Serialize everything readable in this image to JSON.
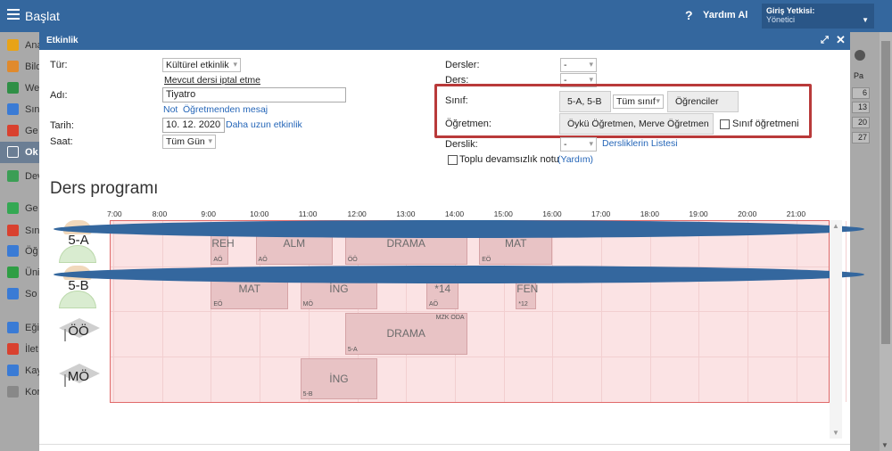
{
  "topbar": {
    "title": "Başlat",
    "help_icon": "?",
    "help_label": "Yardım Al",
    "role_label": "Giriş Yetkisi:",
    "role_value": "Yönetici"
  },
  "sidebar": {
    "items": [
      {
        "label": "Ana",
        "icon": "star-icon",
        "color": "#e8a317"
      },
      {
        "label": "Bild",
        "icon": "mail-icon",
        "color": "#e08a2d"
      },
      {
        "label": "We",
        "icon": "home-icon",
        "color": "#2f8f46"
      },
      {
        "label": "Sın",
        "icon": "board-icon",
        "color": "#3a7bd5"
      },
      {
        "label": "Ge",
        "icon": "person-icon",
        "color": "#d9412f"
      },
      {
        "label": "Ok",
        "icon": "calendar-icon",
        "color": "#ffffff"
      },
      {
        "label": "Dev",
        "icon": "user-icon",
        "color": "#3b9e55"
      },
      {
        "label": "Ge",
        "icon": "check-icon",
        "color": "#34a853"
      },
      {
        "label": "Sın",
        "icon": "badge-icon",
        "color": "#d9412f"
      },
      {
        "label": "Öğ",
        "icon": "card-icon",
        "color": "#3a7bd5"
      },
      {
        "label": "Üni",
        "icon": "shield-icon",
        "color": "#2f9e44"
      },
      {
        "label": "So",
        "icon": "bar-chart-icon",
        "color": "#3a7bd5"
      },
      {
        "label": "Eği",
        "icon": "book-icon",
        "color": "#3a7bd5"
      },
      {
        "label": "İlet",
        "icon": "chat-icon",
        "color": "#d9412f"
      },
      {
        "label": "Kay",
        "icon": "pen-icon",
        "color": "#3a7bd5"
      },
      {
        "label": "Kor",
        "icon": "gear-icon",
        "color": "#888888"
      }
    ]
  },
  "background_panel": {
    "col_header": "Pa",
    "numbers": [
      "6",
      "13",
      "20",
      "27"
    ]
  },
  "modal": {
    "title": "Etkinlik",
    "fields": {
      "type_label": "Tür:",
      "type_value": "Kültürel etkinlik",
      "cancel_link": "Mevcut dersi iptal etme",
      "name_label": "Adı:",
      "name_value": "Tiyatro",
      "note_link": "Not",
      "teacher_msg_link": "Öğretmenden mesaj",
      "date_label": "Tarih:",
      "date_value": "10. 12. 2020",
      "long_event_link": "Daha uzun etkinlik",
      "time_label": "Saat:",
      "time_value": "Tüm Gün",
      "lessons_label": "Dersler:",
      "lessons_value": "-",
      "lesson_label": "Ders:",
      "lesson_value": "-",
      "class_label": "Sınıf:",
      "class_value": "5-A, 5-B",
      "all_class_value": "Tüm sınıf",
      "students_button": "Öğrenciler",
      "teacher_label": "Öğretmen:",
      "teacher_value": "Öykü Öğretmen, Merve Öğretmen",
      "class_teacher_checkbox": "Sınıf öğretmeni",
      "classroom_label": "Derslik:",
      "classroom_value": "-",
      "classroom_list_link": "Dersliklerin Listesi",
      "bulk_absence_checkbox": "Toplu devamsızlık notu",
      "help_link": "(Yardım)"
    },
    "schedule_title": "Ders programı",
    "timeline": [
      "7:00",
      "8:00",
      "9:00",
      "10:00",
      "11:00",
      "12:00",
      "13:00",
      "14:00",
      "15:00",
      "16:00",
      "17:00",
      "18:00",
      "19:00",
      "20:00",
      "21:00"
    ],
    "rows": [
      {
        "label": "5-A",
        "kind": "student",
        "events": [
          {
            "name": "REH",
            "start": "9:00",
            "end": "9:15",
            "sub": "AÖ",
            "tag": ""
          },
          {
            "name": "ALM",
            "start": "9:55",
            "end": "11:30",
            "sub": "AÖ",
            "tag": ""
          },
          {
            "name": "DRAMA",
            "start": "11:45",
            "end": "14:15",
            "sub": "ÖÖ",
            "tag": "MZK ODA"
          },
          {
            "name": "MAT",
            "start": "14:30",
            "end": "16:00",
            "sub": "EÖ",
            "tag": ""
          }
        ]
      },
      {
        "label": "5-B",
        "kind": "student",
        "events": [
          {
            "name": "MAT",
            "start": "9:00",
            "end": "10:35",
            "sub": "EÖ",
            "tag": ""
          },
          {
            "name": "İNG",
            "start": "10:50",
            "end": "12:25",
            "sub": "MÖ",
            "tag": ""
          },
          {
            "name": "*14",
            "start": "13:25",
            "end": "14:05",
            "sub": "AÖ",
            "tag": ""
          },
          {
            "name": "FEN",
            "start": "15:15",
            "end": "15:40",
            "sub": "*12",
            "tag": "MZK ODA"
          }
        ]
      },
      {
        "label": "ÖÖ",
        "kind": "teacher",
        "events": [
          {
            "name": "DRAMA",
            "start": "11:45",
            "end": "14:15",
            "sub": "5-A",
            "tag": "MZK ODA"
          }
        ]
      },
      {
        "label": "MÖ",
        "kind": "teacher",
        "events": [
          {
            "name": "İNG",
            "start": "10:50",
            "end": "12:25",
            "sub": "5-B",
            "tag": ""
          }
        ]
      }
    ]
  }
}
